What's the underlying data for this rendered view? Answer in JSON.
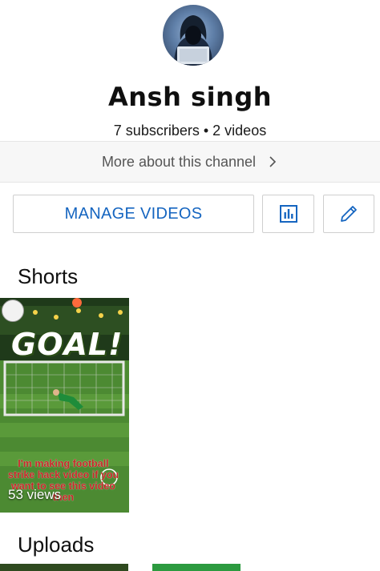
{
  "channel": {
    "avatar_icon": "hooded-hacker-avatar",
    "name": "Ansh singh",
    "subscribers": "7 subscribers",
    "separator": "•",
    "videos": "2 videos",
    "more_about": "More about this channel"
  },
  "actions": {
    "manage_label": "MANAGE VIDEOS",
    "stats_icon": "bar-chart-icon",
    "edit_icon": "pencil-icon",
    "accent_color": "#1565c0"
  },
  "shorts": {
    "title": "Shorts",
    "items": [
      {
        "thumbnail_text": "GOAL!",
        "overlay_text": "I'm making football strike hack video if you want to see this video then",
        "views": "53 views"
      }
    ]
  },
  "uploads": {
    "title": "Uploads"
  }
}
